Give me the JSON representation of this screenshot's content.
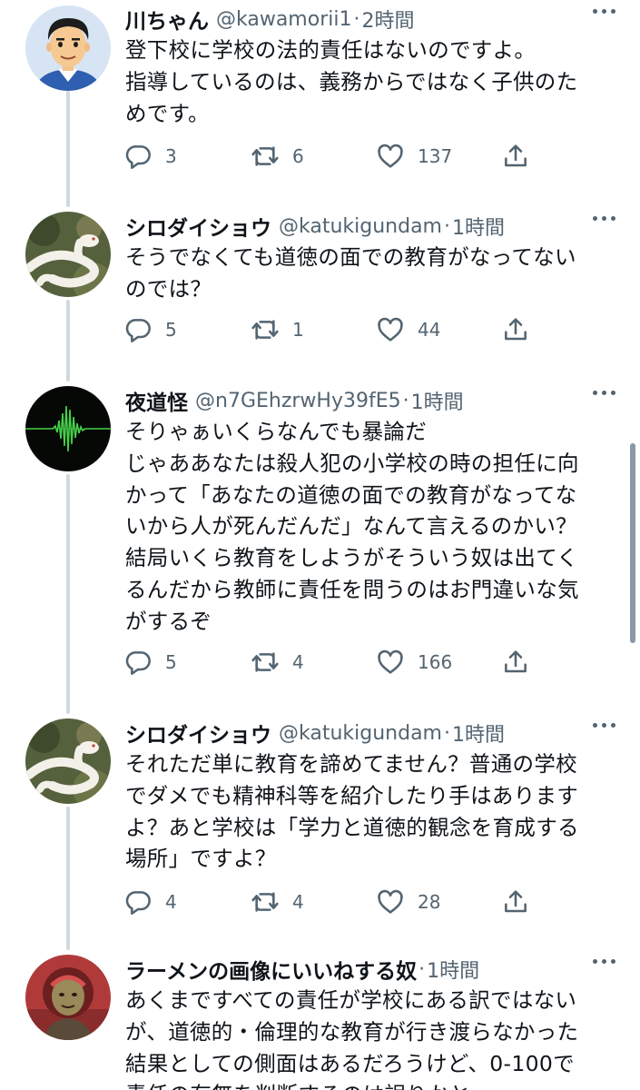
{
  "tweets": [
    {
      "avatar": "cartoon-man-avatar",
      "name": "川ちゃん",
      "handle": "@kawamorii1",
      "time": "2時間",
      "lines": [
        "登下校に学校の法的責任はないのですよ。",
        "指導しているのは、義務からではなく子供のた",
        "めです。"
      ],
      "replies": "3",
      "retweets": "6",
      "likes": "137"
    },
    {
      "avatar": "white-snake-avatar",
      "name": "シロダイショウ",
      "handle": "@katukigundam",
      "time": "1時間",
      "lines": [
        "そうでなくても道徳の面での教育がなってない",
        "のでは？"
      ],
      "replies": "5",
      "retweets": "1",
      "likes": "44"
    },
    {
      "avatar": "green-waveform-avatar",
      "name": "夜道怪",
      "handle": "@n7GEhzrwHy39fE5",
      "time": "1時間",
      "lines": [
        "そりゃぁいくらなんでも暴論だ",
        "じゃああなたは殺人犯の小学校の時の担任に向",
        "かって「あなたの道徳の面での教育がなってな",
        "いから人が死んだんだ」なんて言えるのかい？",
        "結局いくら教育をしようがそういう奴は出てく",
        "るんだから教師に責任を問うのはお門違いな気",
        "がするぞ"
      ],
      "replies": "5",
      "retweets": "4",
      "likes": "166"
    },
    {
      "avatar": "white-snake-avatar",
      "name": "シロダイショウ",
      "handle": "@katukigundam",
      "time": "1時間",
      "lines": [
        "それただ単に教育を諦めてません？普通の学校",
        "でダメでも精神科等を紹介したり手はあります",
        "よ？あと学校は「学力と道徳的観念を育成する",
        "場所」ですよ？"
      ],
      "replies": "4",
      "retweets": "4",
      "likes": "28"
    },
    {
      "avatar": "ramen-person-avatar",
      "name": "ラーメンの画像にいいねする奴",
      "handle": "",
      "time": "1時間",
      "lines": [
        "あくまですべての責任が学校にある訳ではない",
        "が、道徳的・倫理的な教育が行き渡らなかった",
        "結果としての側面はあるだろうけど、0-100で",
        "責任の有無を判断するのは誤りかと"
      ]
    }
  ],
  "icons": {
    "reply": "reply-icon",
    "retweet": "retweet-icon",
    "like": "heart-icon",
    "share": "share-icon",
    "more": "more-icon"
  },
  "colors": {
    "text": "#0f1419",
    "secondary": "#536471",
    "thread_line": "#cfd9de"
  }
}
